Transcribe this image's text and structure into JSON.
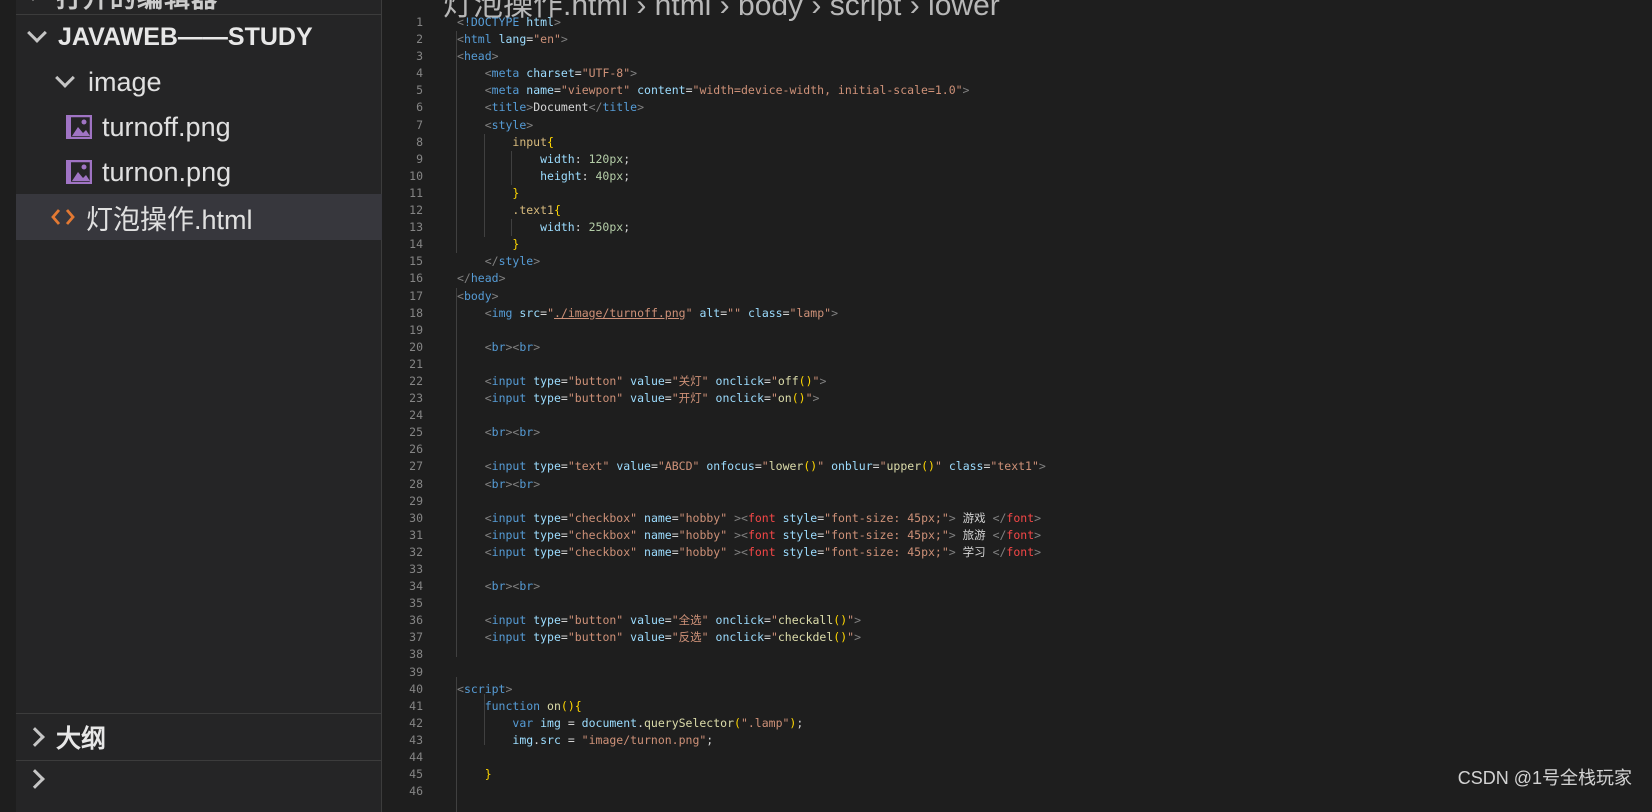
{
  "sidebar": {
    "top_clipped": "打开的编辑器",
    "root": "JAVAWEB——STUDY",
    "folder": "image",
    "files": [
      "turnoff.png",
      "turnon.png"
    ],
    "active_file": "灯泡操作.html",
    "outline": "大纲"
  },
  "breadcrumb": "灯泡操作.html › html › body › script › lower",
  "line_numbers": [
    "1",
    "2",
    "3",
    "4",
    "5",
    "6",
    "7",
    "8",
    "9",
    "10",
    "11",
    "12",
    "13",
    "14",
    "15",
    "16",
    "17",
    "18",
    "19",
    "20",
    "21",
    "22",
    "23",
    "24",
    "25",
    "26",
    "27",
    "28",
    "29",
    "30",
    "31",
    "32",
    "33",
    "34",
    "35",
    "36",
    "37",
    "38",
    "39",
    "40",
    "41",
    "42",
    "43",
    "44",
    "45",
    "46"
  ],
  "code_lines": [
    [
      [
        "t-br",
        "<"
      ],
      [
        "t-tag",
        "!DOCTYPE"
      ],
      [
        "t-plain",
        " "
      ],
      [
        "t-attr",
        "html"
      ],
      [
        "t-br",
        ">"
      ]
    ],
    [
      [
        "t-br",
        "<"
      ],
      [
        "t-tag",
        "html"
      ],
      [
        "t-plain",
        " "
      ],
      [
        "t-attr",
        "lang"
      ],
      [
        "t-plain",
        "="
      ],
      [
        "t-str",
        "\"en\""
      ],
      [
        "t-br",
        ">"
      ]
    ],
    [
      [
        "t-br",
        "<"
      ],
      [
        "t-tag",
        "head"
      ],
      [
        "t-br",
        ">"
      ]
    ],
    [
      [
        "t-plain",
        "    "
      ],
      [
        "t-br",
        "<"
      ],
      [
        "t-tag",
        "meta"
      ],
      [
        "t-plain",
        " "
      ],
      [
        "t-attr",
        "charset"
      ],
      [
        "t-plain",
        "="
      ],
      [
        "t-str",
        "\"UTF-8\""
      ],
      [
        "t-br",
        ">"
      ]
    ],
    [
      [
        "t-plain",
        "    "
      ],
      [
        "t-br",
        "<"
      ],
      [
        "t-tag",
        "meta"
      ],
      [
        "t-plain",
        " "
      ],
      [
        "t-attr",
        "name"
      ],
      [
        "t-plain",
        "="
      ],
      [
        "t-str",
        "\"viewport\""
      ],
      [
        "t-plain",
        " "
      ],
      [
        "t-attr",
        "content"
      ],
      [
        "t-plain",
        "="
      ],
      [
        "t-str",
        "\"width=device-width, initial-scale=1.0\""
      ],
      [
        "t-br",
        ">"
      ]
    ],
    [
      [
        "t-plain",
        "    "
      ],
      [
        "t-br",
        "<"
      ],
      [
        "t-tag",
        "title"
      ],
      [
        "t-br",
        ">"
      ],
      [
        "t-plain",
        "Document"
      ],
      [
        "t-br",
        "</"
      ],
      [
        "t-tag",
        "title"
      ],
      [
        "t-br",
        ">"
      ]
    ],
    [
      [
        "t-plain",
        "    "
      ],
      [
        "t-br",
        "<"
      ],
      [
        "t-tag",
        "style"
      ],
      [
        "t-br",
        ">"
      ]
    ],
    [
      [
        "t-plain",
        "        "
      ],
      [
        "t-sel",
        "input"
      ],
      [
        "t-brace",
        "{"
      ]
    ],
    [
      [
        "t-plain",
        "            "
      ],
      [
        "t-attr",
        "width"
      ],
      [
        "t-plain",
        ": "
      ],
      [
        "t-num",
        "120px"
      ],
      [
        "t-plain",
        ";"
      ]
    ],
    [
      [
        "t-plain",
        "            "
      ],
      [
        "t-attr",
        "height"
      ],
      [
        "t-plain",
        ": "
      ],
      [
        "t-num",
        "40px"
      ],
      [
        "t-plain",
        ";"
      ]
    ],
    [
      [
        "t-plain",
        "        "
      ],
      [
        "t-brace",
        "}"
      ]
    ],
    [
      [
        "t-plain",
        "        "
      ],
      [
        "t-sel",
        ".text1"
      ],
      [
        "t-brace",
        "{"
      ]
    ],
    [
      [
        "t-plain",
        "            "
      ],
      [
        "t-attr",
        "width"
      ],
      [
        "t-plain",
        ": "
      ],
      [
        "t-num",
        "250px"
      ],
      [
        "t-plain",
        ";"
      ]
    ],
    [
      [
        "t-plain",
        "        "
      ],
      [
        "t-brace",
        "}"
      ]
    ],
    [
      [
        "t-plain",
        "    "
      ],
      [
        "t-br",
        "</"
      ],
      [
        "t-tag",
        "style"
      ],
      [
        "t-br",
        ">"
      ]
    ],
    [
      [
        "t-br",
        "</"
      ],
      [
        "t-tag",
        "head"
      ],
      [
        "t-br",
        ">"
      ]
    ],
    [
      [
        "t-br",
        "<"
      ],
      [
        "t-tag",
        "body"
      ],
      [
        "t-br",
        ">"
      ]
    ],
    [
      [
        "t-plain",
        "    "
      ],
      [
        "t-br",
        "<"
      ],
      [
        "t-tag",
        "img"
      ],
      [
        "t-plain",
        " "
      ],
      [
        "t-attr",
        "src"
      ],
      [
        "t-plain",
        "="
      ],
      [
        "t-str",
        "\""
      ],
      [
        "t-str t-ul",
        "./image/turnoff.png"
      ],
      [
        "t-str",
        "\""
      ],
      [
        "t-plain",
        " "
      ],
      [
        "t-attr",
        "alt"
      ],
      [
        "t-plain",
        "="
      ],
      [
        "t-str",
        "\"\""
      ],
      [
        "t-plain",
        " "
      ],
      [
        "t-attr",
        "class"
      ],
      [
        "t-plain",
        "="
      ],
      [
        "t-str",
        "\"lamp\""
      ],
      [
        "t-br",
        ">"
      ]
    ],
    [],
    [
      [
        "t-plain",
        "    "
      ],
      [
        "t-br",
        "<"
      ],
      [
        "t-tag",
        "br"
      ],
      [
        "t-br",
        "><"
      ],
      [
        "t-tag",
        "br"
      ],
      [
        "t-br",
        ">"
      ]
    ],
    [],
    [
      [
        "t-plain",
        "    "
      ],
      [
        "t-br",
        "<"
      ],
      [
        "t-tag",
        "input"
      ],
      [
        "t-plain",
        " "
      ],
      [
        "t-attr",
        "type"
      ],
      [
        "t-plain",
        "="
      ],
      [
        "t-str",
        "\"button\""
      ],
      [
        "t-plain",
        " "
      ],
      [
        "t-attr",
        "value"
      ],
      [
        "t-plain",
        "="
      ],
      [
        "t-str",
        "\"关灯\""
      ],
      [
        "t-plain",
        " "
      ],
      [
        "t-attr",
        "onclick"
      ],
      [
        "t-plain",
        "="
      ],
      [
        "t-str",
        "\""
      ],
      [
        "t-fn",
        "off"
      ],
      [
        "t-brace",
        "()"
      ],
      [
        "t-str",
        "\""
      ],
      [
        "t-br",
        ">"
      ]
    ],
    [
      [
        "t-plain",
        "    "
      ],
      [
        "t-br",
        "<"
      ],
      [
        "t-tag",
        "input"
      ],
      [
        "t-plain",
        " "
      ],
      [
        "t-attr",
        "type"
      ],
      [
        "t-plain",
        "="
      ],
      [
        "t-str",
        "\"button\""
      ],
      [
        "t-plain",
        " "
      ],
      [
        "t-attr",
        "value"
      ],
      [
        "t-plain",
        "="
      ],
      [
        "t-str",
        "\"开灯\""
      ],
      [
        "t-plain",
        " "
      ],
      [
        "t-attr",
        "onclick"
      ],
      [
        "t-plain",
        "="
      ],
      [
        "t-str",
        "\""
      ],
      [
        "t-fn",
        "on"
      ],
      [
        "t-brace",
        "()"
      ],
      [
        "t-str",
        "\""
      ],
      [
        "t-br",
        ">"
      ]
    ],
    [],
    [
      [
        "t-plain",
        "    "
      ],
      [
        "t-br",
        "<"
      ],
      [
        "t-tag",
        "br"
      ],
      [
        "t-br",
        "><"
      ],
      [
        "t-tag",
        "br"
      ],
      [
        "t-br",
        ">"
      ]
    ],
    [],
    [
      [
        "t-plain",
        "    "
      ],
      [
        "t-br",
        "<"
      ],
      [
        "t-tag",
        "input"
      ],
      [
        "t-plain",
        " "
      ],
      [
        "t-attr",
        "type"
      ],
      [
        "t-plain",
        "="
      ],
      [
        "t-str",
        "\"text\""
      ],
      [
        "t-plain",
        " "
      ],
      [
        "t-attr",
        "value"
      ],
      [
        "t-plain",
        "="
      ],
      [
        "t-str",
        "\"ABCD\""
      ],
      [
        "t-plain",
        " "
      ],
      [
        "t-attr",
        "onfocus"
      ],
      [
        "t-plain",
        "="
      ],
      [
        "t-str",
        "\""
      ],
      [
        "t-fn",
        "lower"
      ],
      [
        "t-brace",
        "()"
      ],
      [
        "t-str",
        "\""
      ],
      [
        "t-plain",
        " "
      ],
      [
        "t-attr",
        "onblur"
      ],
      [
        "t-plain",
        "="
      ],
      [
        "t-str",
        "\""
      ],
      [
        "t-fn",
        "upper"
      ],
      [
        "t-brace",
        "()"
      ],
      [
        "t-str",
        "\""
      ],
      [
        "t-plain",
        " "
      ],
      [
        "t-attr",
        "class"
      ],
      [
        "t-plain",
        "="
      ],
      [
        "t-str",
        "\"text1\""
      ],
      [
        "t-br",
        ">"
      ]
    ],
    [
      [
        "t-plain",
        "    "
      ],
      [
        "t-br",
        "<"
      ],
      [
        "t-tag",
        "br"
      ],
      [
        "t-br",
        "><"
      ],
      [
        "t-tag",
        "br"
      ],
      [
        "t-br",
        ">"
      ]
    ],
    [],
    [
      [
        "t-plain",
        "    "
      ],
      [
        "t-br",
        "<"
      ],
      [
        "t-tag",
        "input"
      ],
      [
        "t-plain",
        " "
      ],
      [
        "t-attr",
        "type"
      ],
      [
        "t-plain",
        "="
      ],
      [
        "t-str",
        "\"checkbox\""
      ],
      [
        "t-plain",
        " "
      ],
      [
        "t-attr",
        "name"
      ],
      [
        "t-plain",
        "="
      ],
      [
        "t-str",
        "\"hobby\""
      ],
      [
        "t-plain",
        " "
      ],
      [
        "t-br",
        "><"
      ],
      [
        "t-red",
        "font"
      ],
      [
        "t-plain",
        " "
      ],
      [
        "t-attr",
        "style"
      ],
      [
        "t-plain",
        "="
      ],
      [
        "t-str",
        "\"font-size: 45px;\""
      ],
      [
        "t-br",
        ">"
      ],
      [
        "t-plain",
        " 游戏 "
      ],
      [
        "t-br",
        "</"
      ],
      [
        "t-red",
        "font"
      ],
      [
        "t-br",
        ">"
      ]
    ],
    [
      [
        "t-plain",
        "    "
      ],
      [
        "t-br",
        "<"
      ],
      [
        "t-tag",
        "input"
      ],
      [
        "t-plain",
        " "
      ],
      [
        "t-attr",
        "type"
      ],
      [
        "t-plain",
        "="
      ],
      [
        "t-str",
        "\"checkbox\""
      ],
      [
        "t-plain",
        " "
      ],
      [
        "t-attr",
        "name"
      ],
      [
        "t-plain",
        "="
      ],
      [
        "t-str",
        "\"hobby\""
      ],
      [
        "t-plain",
        " "
      ],
      [
        "t-br",
        "><"
      ],
      [
        "t-red",
        "font"
      ],
      [
        "t-plain",
        " "
      ],
      [
        "t-attr",
        "style"
      ],
      [
        "t-plain",
        "="
      ],
      [
        "t-str",
        "\"font-size: 45px;\""
      ],
      [
        "t-br",
        ">"
      ],
      [
        "t-plain",
        " 旅游 "
      ],
      [
        "t-br",
        "</"
      ],
      [
        "t-red",
        "font"
      ],
      [
        "t-br",
        ">"
      ]
    ],
    [
      [
        "t-plain",
        "    "
      ],
      [
        "t-br",
        "<"
      ],
      [
        "t-tag",
        "input"
      ],
      [
        "t-plain",
        " "
      ],
      [
        "t-attr",
        "type"
      ],
      [
        "t-plain",
        "="
      ],
      [
        "t-str",
        "\"checkbox\""
      ],
      [
        "t-plain",
        " "
      ],
      [
        "t-attr",
        "name"
      ],
      [
        "t-plain",
        "="
      ],
      [
        "t-str",
        "\"hobby\""
      ],
      [
        "t-plain",
        " "
      ],
      [
        "t-br",
        "><"
      ],
      [
        "t-red",
        "font"
      ],
      [
        "t-plain",
        " "
      ],
      [
        "t-attr",
        "style"
      ],
      [
        "t-plain",
        "="
      ],
      [
        "t-str",
        "\"font-size: 45px;\""
      ],
      [
        "t-br",
        ">"
      ],
      [
        "t-plain",
        " 学习 "
      ],
      [
        "t-br",
        "</"
      ],
      [
        "t-red",
        "font"
      ],
      [
        "t-br",
        ">"
      ]
    ],
    [],
    [
      [
        "t-plain",
        "    "
      ],
      [
        "t-br",
        "<"
      ],
      [
        "t-tag",
        "br"
      ],
      [
        "t-br",
        "><"
      ],
      [
        "t-tag",
        "br"
      ],
      [
        "t-br",
        ">"
      ]
    ],
    [],
    [
      [
        "t-plain",
        "    "
      ],
      [
        "t-br",
        "<"
      ],
      [
        "t-tag",
        "input"
      ],
      [
        "t-plain",
        " "
      ],
      [
        "t-attr",
        "type"
      ],
      [
        "t-plain",
        "="
      ],
      [
        "t-str",
        "\"button\""
      ],
      [
        "t-plain",
        " "
      ],
      [
        "t-attr",
        "value"
      ],
      [
        "t-plain",
        "="
      ],
      [
        "t-str",
        "\"全选\""
      ],
      [
        "t-plain",
        " "
      ],
      [
        "t-attr",
        "onclick"
      ],
      [
        "t-plain",
        "="
      ],
      [
        "t-str",
        "\""
      ],
      [
        "t-fn",
        "checkall"
      ],
      [
        "t-brace",
        "()"
      ],
      [
        "t-str",
        "\""
      ],
      [
        "t-br",
        ">"
      ]
    ],
    [
      [
        "t-plain",
        "    "
      ],
      [
        "t-br",
        "<"
      ],
      [
        "t-tag",
        "input"
      ],
      [
        "t-plain",
        " "
      ],
      [
        "t-attr",
        "type"
      ],
      [
        "t-plain",
        "="
      ],
      [
        "t-str",
        "\"button\""
      ],
      [
        "t-plain",
        " "
      ],
      [
        "t-attr",
        "value"
      ],
      [
        "t-plain",
        "="
      ],
      [
        "t-str",
        "\"反选\""
      ],
      [
        "t-plain",
        " "
      ],
      [
        "t-attr",
        "onclick"
      ],
      [
        "t-plain",
        "="
      ],
      [
        "t-str",
        "\""
      ],
      [
        "t-fn",
        "checkdel"
      ],
      [
        "t-brace",
        "()"
      ],
      [
        "t-str",
        "\""
      ],
      [
        "t-br",
        ">"
      ]
    ],
    [],
    [],
    [
      [
        "t-br",
        "<"
      ],
      [
        "t-tag",
        "script"
      ],
      [
        "t-br",
        ">"
      ]
    ],
    [
      [
        "t-plain",
        "    "
      ],
      [
        "t-kw",
        "function"
      ],
      [
        "t-plain",
        " "
      ],
      [
        "t-fn",
        "on"
      ],
      [
        "t-brace",
        "(){"
      ]
    ],
    [
      [
        "t-plain",
        "        "
      ],
      [
        "t-kw",
        "var"
      ],
      [
        "t-plain",
        " "
      ],
      [
        "t-attr",
        "img"
      ],
      [
        "t-plain",
        " = "
      ],
      [
        "t-attr",
        "document"
      ],
      [
        "t-plain",
        "."
      ],
      [
        "t-fn",
        "querySelector"
      ],
      [
        "t-brace",
        "("
      ],
      [
        "t-str",
        "\".lamp\""
      ],
      [
        "t-brace",
        ")"
      ],
      [
        "t-plain",
        ";"
      ]
    ],
    [
      [
        "t-plain",
        "        "
      ],
      [
        "t-attr",
        "img"
      ],
      [
        "t-plain",
        "."
      ],
      [
        "t-attr",
        "src"
      ],
      [
        "t-plain",
        " = "
      ],
      [
        "t-str",
        "\"image/turnon.png\""
      ],
      [
        "t-plain",
        ";"
      ]
    ],
    [],
    [
      [
        "t-plain",
        "    "
      ],
      [
        "t-brace",
        "}"
      ]
    ],
    []
  ],
  "watermark": "CSDN @1号全栈玩家"
}
